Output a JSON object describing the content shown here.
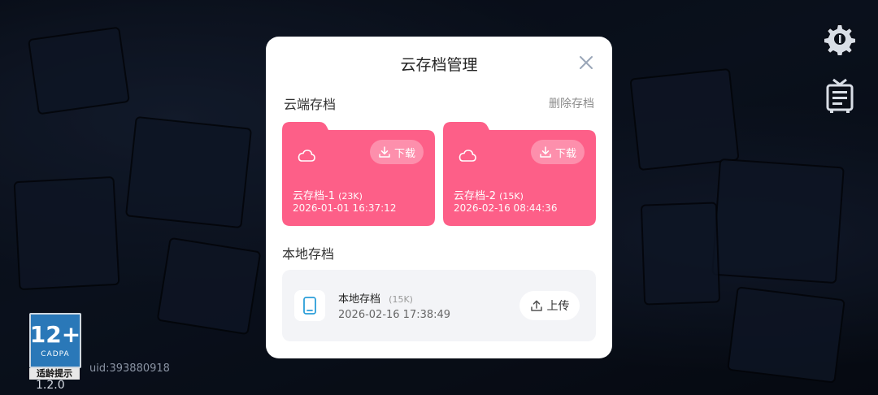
{
  "dialog": {
    "title": "云存档管理",
    "cloud_section_label": "云端存档",
    "delete_label": "删除存档",
    "local_section_label": "本地存档"
  },
  "cloud_saves": [
    {
      "name": "云存档-1",
      "size": "(23K)",
      "time": "2026-01-01 16:37:12",
      "download_label": "下载"
    },
    {
      "name": "云存档-2",
      "size": "(15K)",
      "time": "2026-02-16 08:44:36",
      "download_label": "下载"
    }
  ],
  "local_save": {
    "name": "本地存档",
    "size": "(15K)",
    "time": "2026-02-16 17:38:49",
    "upload_label": "上传"
  },
  "hud": {
    "age_rating": "12+",
    "age_org": "CADPA",
    "age_tip": "适龄提示",
    "version": "1.2.0",
    "uid": "uid:393880918"
  },
  "colors": {
    "folder": "#fd5f88",
    "folder_tab": "#fd5f88",
    "dialog_bg": "#ffffff",
    "local_card_bg": "#f3f4f7",
    "phone_icon": "#2b9fd9"
  },
  "icons": [
    "gear-icon",
    "board-icon",
    "close-icon",
    "cloud-icon",
    "download-icon",
    "upload-icon",
    "phone-icon"
  ]
}
